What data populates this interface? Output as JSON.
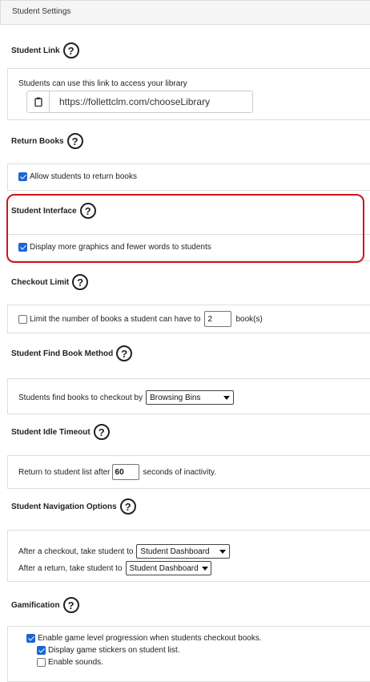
{
  "header": {
    "title": "Student Settings"
  },
  "sections": {
    "student_link": {
      "title": "Student Link",
      "description": "Students can use this link to access your library",
      "url": "https://follettclm.com/chooseLibrary"
    },
    "return_books": {
      "title": "Return Books",
      "option_label": "Allow students to return books",
      "checked": true
    },
    "student_interface": {
      "title": "Student Interface",
      "option_label": "Display more graphics and fewer words to students",
      "checked": true
    },
    "checkout_limit": {
      "title": "Checkout Limit",
      "label_before": "Limit the number of books a student can have to",
      "value": "2",
      "label_after": "book(s)",
      "checked": false
    },
    "find_book_method": {
      "title": "Student Find Book Method",
      "label": "Students find books to checkout by",
      "selected": "Browsing Bins"
    },
    "idle_timeout": {
      "title": "Student Idle Timeout",
      "label_before": "Return to student list after",
      "value": "60",
      "label_after": "seconds of inactivity."
    },
    "navigation_options": {
      "title": "Student Navigation Options",
      "after_checkout_label": "After a checkout, take student to",
      "after_checkout_selected": "Student Dashboard",
      "after_return_label": "After a return, take student to",
      "after_return_selected": "Student Dashboard"
    },
    "gamification": {
      "title": "Gamification",
      "level_progression_label": "Enable game level progression when students checkout books.",
      "stickers_label": "Display game stickers on student list.",
      "sounds_label": "Enable sounds."
    }
  },
  "icons": {
    "help": "?"
  },
  "colors": {
    "accent": "#1a66d6",
    "highlight": "#d0151a"
  }
}
